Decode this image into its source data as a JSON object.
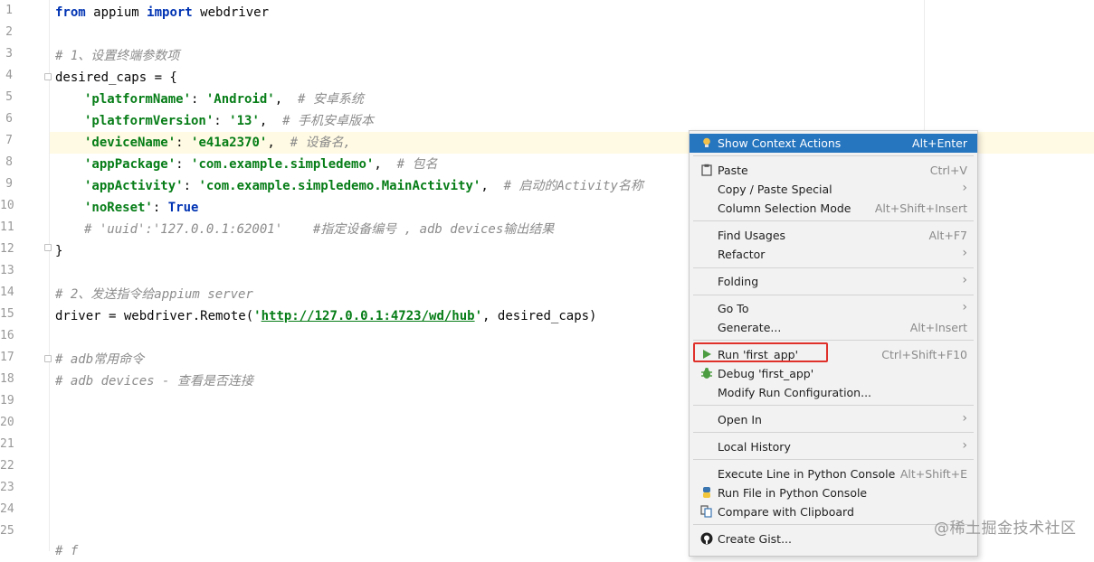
{
  "editor": {
    "line_numbers": [
      "1",
      "2",
      "3",
      "4",
      "5",
      "6",
      "7",
      "8",
      "9",
      "10",
      "11",
      "12",
      "13",
      "14",
      "15",
      "16",
      "17",
      "18",
      "19",
      "20",
      "21",
      "22",
      "23",
      "24",
      "25"
    ],
    "line1": {
      "kw_from": "from",
      "mod": " appium ",
      "kw_import": "import",
      "rest": " webdriver"
    },
    "line3": "# 1、设置终端参数项",
    "line4": "desired_caps = {",
    "line5": {
      "key": "'platformName'",
      "sep": ": ",
      "val": "'Android'",
      "comma": ",  ",
      "comment": "# 安卓系统"
    },
    "line6": {
      "key": "'platformVersion'",
      "sep": ": ",
      "val": "'13'",
      "comma": ",  ",
      "comment": "# 手机安卓版本"
    },
    "line7": {
      "key": "'deviceName'",
      "sep": ": ",
      "val": "'e41a2370'",
      "comma": ",  ",
      "comment": "# 设备名,"
    },
    "line8": {
      "key": "'appPackage'",
      "sep": ": ",
      "val": "'com.example.simpledemo'",
      "comma": ",  ",
      "comment": "# 包名"
    },
    "line9": {
      "key": "'appActivity'",
      "sep": ": ",
      "val": "'com.example.simpledemo.MainActivity'",
      "comma": ",  ",
      "comment": "# 启动的Activity名称"
    },
    "line10": {
      "key": "'noReset'",
      "sep": ": ",
      "val": "True"
    },
    "line11": "# 'uuid':'127.0.0.1:62001'    #指定设备编号 , adb devices输出结果",
    "line12": "}",
    "line14": "# 2、发送指令给appium server",
    "line15": {
      "pre": "driver = webdriver.Remote(",
      "q1": "'",
      "url": "http://127.0.0.1:4723/wd/hub",
      "q2": "'",
      "post": ", desired_caps)"
    },
    "line17": "# adb常用命令",
    "line18": "# adb devices - 查看是否连接",
    "line26": "# f"
  },
  "context_menu": {
    "items": [
      {
        "label": "Show Context Actions",
        "shortcut": "Alt+Enter",
        "icon": "bulb-icon"
      },
      {
        "label": "Paste",
        "shortcut": "Ctrl+V",
        "icon": "clipboard-icon"
      },
      {
        "label": "Copy / Paste Special",
        "submenu": "›"
      },
      {
        "label": "Column Selection Mode",
        "shortcut": "Alt+Shift+Insert"
      },
      {
        "label": "Find Usages",
        "shortcut": "Alt+F7"
      },
      {
        "label": "Refactor",
        "submenu": "›"
      },
      {
        "label": "Folding",
        "submenu": "›"
      },
      {
        "label": "Go To",
        "submenu": "›"
      },
      {
        "label": "Generate...",
        "shortcut": "Alt+Insert"
      },
      {
        "label": "Run 'first_app'",
        "shortcut": "Ctrl+Shift+F10",
        "icon": "run-triangle-icon"
      },
      {
        "label": "Debug 'first_app'",
        "icon": "debug-bug-icon"
      },
      {
        "label": "Modify Run Configuration..."
      },
      {
        "label": "Open In",
        "submenu": "›"
      },
      {
        "label": "Local History",
        "submenu": "›"
      },
      {
        "label": "Execute Line in Python Console",
        "shortcut": "Alt+Shift+E"
      },
      {
        "label": "Run File in Python Console",
        "icon": "python-icon"
      },
      {
        "label": "Compare with Clipboard",
        "icon": "compare-icon"
      },
      {
        "label": "Create Gist...",
        "icon": "github-icon"
      }
    ]
  },
  "watermark": "@稀土掘金技术社区",
  "colors": {
    "selection": "#2675bf",
    "run_highlight_box": "#e0302a",
    "keyword": "#0033b3",
    "string": "#067d17",
    "comment": "#8c8c8c"
  }
}
